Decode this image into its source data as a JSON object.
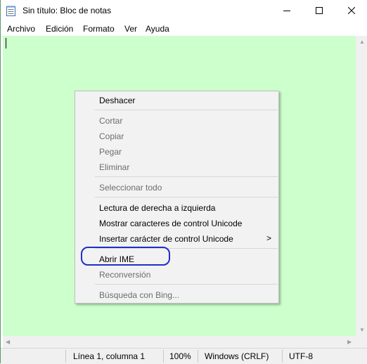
{
  "window": {
    "title": "Sin título: Bloc de notas",
    "controls": [
      "minimize-icon",
      "maximize-icon",
      "close-icon"
    ]
  },
  "menubar": {
    "items": [
      "Archivo",
      "Edición",
      "Formato",
      "Ver",
      "Ayuda"
    ]
  },
  "editor": {
    "background": "#ccffcc",
    "text": ""
  },
  "context_menu": {
    "items": [
      {
        "label": "Deshacer",
        "enabled": true
      },
      {
        "label": "Cortar",
        "enabled": false
      },
      {
        "label": "Copiar",
        "enabled": false
      },
      {
        "label": "Pegar",
        "enabled": false
      },
      {
        "label": "Eliminar",
        "enabled": false
      },
      {
        "label": "Seleccionar todo",
        "enabled": false
      },
      {
        "label": "Lectura de derecha a izquierda",
        "enabled": true
      },
      {
        "label": "Mostrar caracteres de control Unicode",
        "enabled": true
      },
      {
        "label": "Insertar carácter de control Unicode",
        "enabled": true,
        "submenu": ">"
      },
      {
        "label": "Abrir IME",
        "enabled": true,
        "highlighted": true
      },
      {
        "label": "Reconversión",
        "enabled": false
      },
      {
        "label": "Búsqueda con Bing...",
        "enabled": false
      }
    ],
    "highlight_color": "#1f2fcc"
  },
  "statusbar": {
    "position": "Línea 1, columna 1",
    "zoom": "100%",
    "line_ending": "Windows (CRLF)",
    "encoding": "UTF-8"
  }
}
